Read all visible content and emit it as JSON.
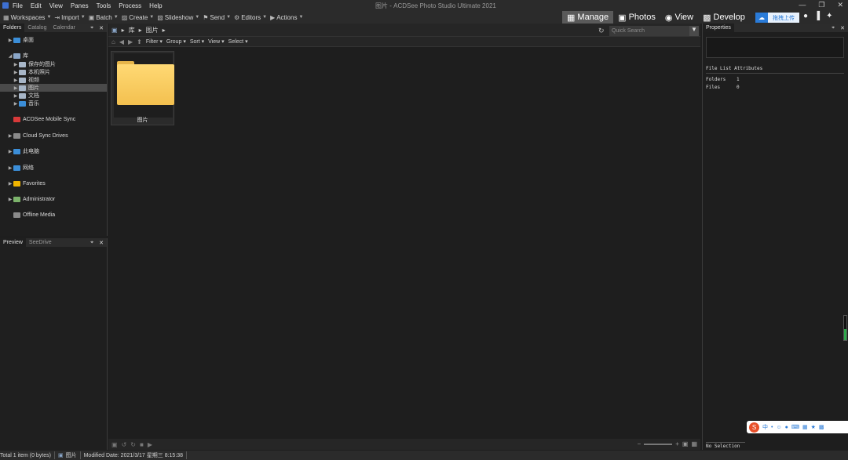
{
  "window": {
    "title": "图片 - ACDSee Photo Studio Ultimate 2021",
    "menu": [
      "File",
      "Edit",
      "View",
      "Panes",
      "Tools",
      "Process",
      "Help"
    ],
    "controls": [
      "—",
      "❐",
      "✕"
    ]
  },
  "toolbar": {
    "items": [
      {
        "label": "Workspaces",
        "icon": "workspaces-icon",
        "glyph": "▦"
      },
      {
        "label": "Import",
        "icon": "import-icon",
        "glyph": "⇥"
      },
      {
        "label": "Batch",
        "icon": "batch-icon",
        "glyph": "▣"
      },
      {
        "label": "Create",
        "icon": "create-icon",
        "glyph": "▨"
      },
      {
        "label": "Slideshow",
        "icon": "slideshow-icon",
        "glyph": "▧"
      },
      {
        "label": "Send",
        "icon": "send-icon",
        "glyph": "⚑"
      },
      {
        "label": "Editors",
        "icon": "editors-icon",
        "glyph": "⚙"
      },
      {
        "label": "Actions",
        "icon": "actions-icon",
        "glyph": "▶"
      }
    ],
    "modes": [
      {
        "label": "Manage",
        "glyph": "▦",
        "active": true
      },
      {
        "label": "Photos",
        "glyph": "▣",
        "active": false
      },
      {
        "label": "View",
        "glyph": "◉",
        "active": false
      },
      {
        "label": "Develop",
        "glyph": "▩",
        "active": false
      }
    ],
    "upload_label": "拖拽上传",
    "upload_glyph": "☁",
    "right_glyphs": [
      "●",
      "▐",
      "✦"
    ]
  },
  "folders_panel": {
    "tabs": [
      "Folders",
      "Catalog",
      "Calendar"
    ],
    "controls": [
      "⌖",
      "✕"
    ],
    "tree": [
      {
        "label": "桌面",
        "depth": 0,
        "icon": "desktop-icon",
        "color": "#3b8ed8",
        "arrow": "▶"
      },
      {
        "label": "库",
        "depth": 0,
        "icon": "library-icon",
        "color": "#8aa6c8",
        "arrow": "◢"
      },
      {
        "label": "保存的图片",
        "depth": 1,
        "icon": "saved-pictures-icon",
        "color": "#a7b6c8",
        "arrow": "▶"
      },
      {
        "label": "本机照片",
        "depth": 1,
        "icon": "camera-roll-icon",
        "color": "#a7b6c8",
        "arrow": "▶"
      },
      {
        "label": "视频",
        "depth": 1,
        "icon": "videos-icon",
        "color": "#a7b6c8",
        "arrow": "▶"
      },
      {
        "label": "图片",
        "depth": 1,
        "icon": "pictures-icon",
        "color": "#a7b6c8",
        "arrow": "▶",
        "selected": true
      },
      {
        "label": "文档",
        "depth": 1,
        "icon": "documents-icon",
        "color": "#a7b6c8",
        "arrow": "▶"
      },
      {
        "label": "音乐",
        "depth": 1,
        "icon": "music-icon",
        "color": "#3b8ed8",
        "arrow": "▶"
      },
      {
        "label": "ACDSee Mobile Sync",
        "depth": 0,
        "icon": "mobile-sync-icon",
        "color": "#d83a3a",
        "arrow": ""
      },
      {
        "label": "Cloud Sync Drives",
        "depth": 0,
        "icon": "cloud-sync-icon",
        "color": "#8a8a8a",
        "arrow": "▶"
      },
      {
        "label": "此电脑",
        "depth": 0,
        "icon": "this-pc-icon",
        "color": "#3b8ed8",
        "arrow": "▶"
      },
      {
        "label": "网络",
        "depth": 0,
        "icon": "network-icon",
        "color": "#3b8ed8",
        "arrow": "▶"
      },
      {
        "label": "Favorites",
        "depth": 0,
        "icon": "favorites-icon",
        "color": "#f0b400",
        "arrow": "▶"
      },
      {
        "label": "Administrator",
        "depth": 0,
        "icon": "administrator-icon",
        "color": "#7cb36b",
        "arrow": "▶"
      },
      {
        "label": "Offline Media",
        "depth": 0,
        "icon": "offline-media-icon",
        "color": "#8a8a8a",
        "arrow": ""
      }
    ]
  },
  "preview_panel": {
    "tabs": [
      "Preview",
      "SeeDrive"
    ],
    "controls": [
      "⌖",
      "✕"
    ]
  },
  "browser": {
    "breadcrumb": [
      "库",
      "图片"
    ],
    "breadcrumb_glyph": "▣",
    "breadcrumb_sep": "▸",
    "search_placeholder": "Quick Search",
    "search_glyph": "↻",
    "filter_glyph": "▼",
    "nav_glyphs": [
      "⌂",
      "◀",
      "▶",
      "⬆"
    ],
    "filters": [
      "Filter",
      "Group",
      "Sort",
      "View",
      "Select"
    ],
    "dropdown_glyph": "▾",
    "items": [
      {
        "label": "图片",
        "type": "folder"
      }
    ],
    "bottom_glyphs": [
      "▣",
      "↺",
      "↻",
      "■",
      "▶"
    ],
    "zoom_glyphs": [
      "−",
      "+",
      "▣",
      "▦"
    ]
  },
  "properties_panel": {
    "title": "Properties",
    "controls": [
      "⌖",
      "✕"
    ],
    "section": "File List Attributes",
    "attributes": [
      {
        "key": "Folders",
        "value": "1"
      },
      {
        "key": "Files",
        "value": "0"
      }
    ],
    "selection_tab": "No Selection"
  },
  "ime_bar": {
    "logo": "S",
    "items": [
      "中",
      "•",
      "☺",
      "●",
      "⌨",
      "▦",
      "★",
      "▩"
    ]
  },
  "status": {
    "count": "Total 1 item  (0 bytes)",
    "location": "图片",
    "location_glyph": "▣",
    "modified": "Modified Date: 2021/3/17 星期三 8:15:38"
  }
}
